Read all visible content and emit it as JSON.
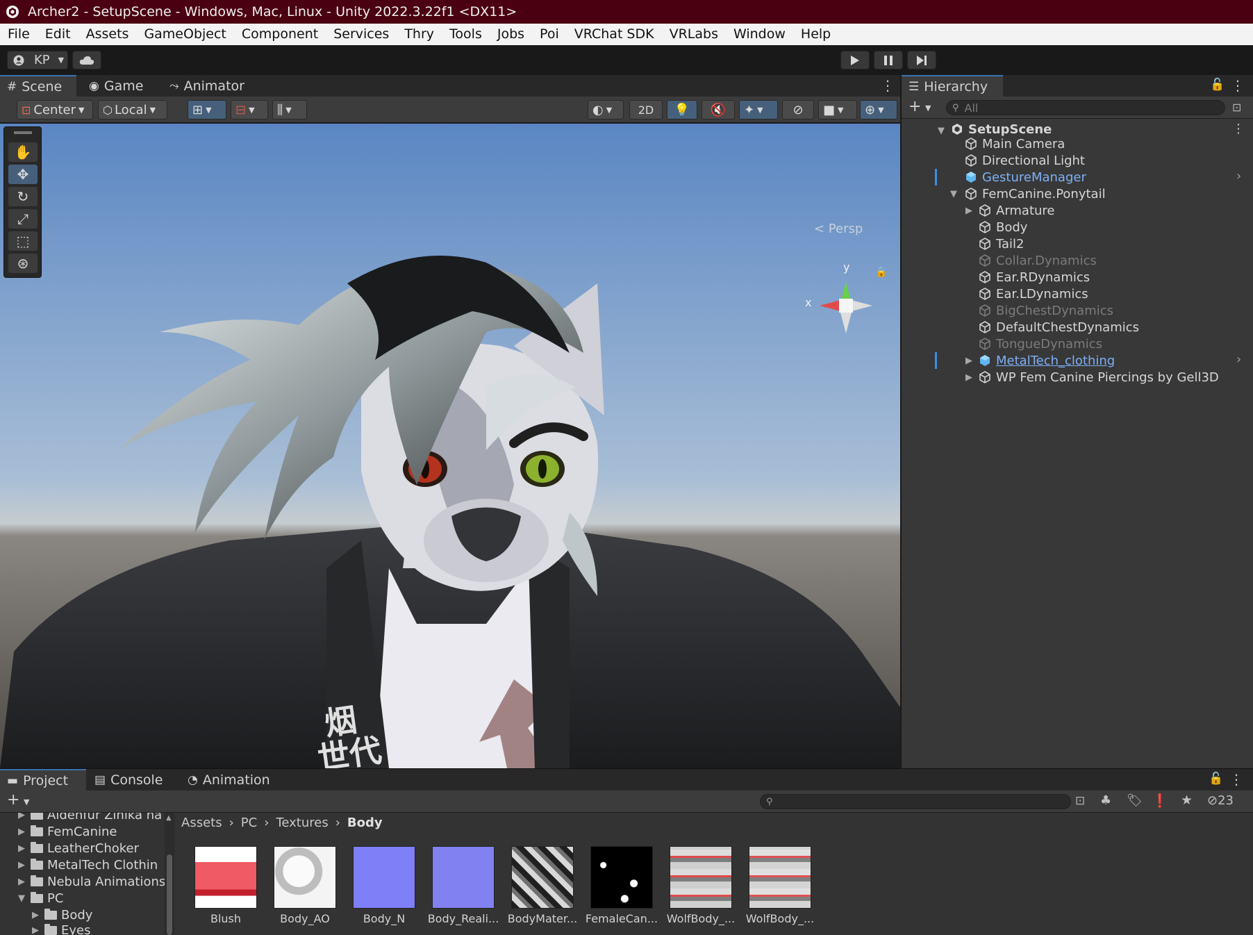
{
  "window": {
    "title": "Archer2 - SetupScene - Windows, Mac, Linux - Unity 2022.3.22f1 <DX11>"
  },
  "menu": [
    "File",
    "Edit",
    "Assets",
    "GameObject",
    "Component",
    "Services",
    "Thry",
    "Tools",
    "Jobs",
    "Poi",
    "VRChat SDK",
    "VRLabs",
    "Window",
    "Help"
  ],
  "toolbar": {
    "account": "KP",
    "play_icon": "play-icon",
    "pause_icon": "pause-icon",
    "step_icon": "step-icon"
  },
  "scene_tabs": {
    "scene": "Scene",
    "game": "Game",
    "animator": "Animator"
  },
  "scene_toolbar": {
    "pivot": "Center",
    "space": "Local",
    "mode_2d": "2D"
  },
  "gizmo": {
    "y_label": "y",
    "x_label": "x",
    "persp": "< Persp"
  },
  "hierarchy": {
    "title": "Hierarchy",
    "search_placeholder": "All",
    "scene": "SetupScene",
    "items": [
      {
        "label": "Main Camera",
        "state": "normal"
      },
      {
        "label": "Directional Light",
        "state": "normal"
      },
      {
        "label": "GestureManager",
        "state": "prefab"
      },
      {
        "label": "FemCanine.Ponytail",
        "state": "normal"
      },
      {
        "label": "Armature",
        "state": "normal"
      },
      {
        "label": "Body",
        "state": "normal"
      },
      {
        "label": "Tail2",
        "state": "normal"
      },
      {
        "label": "Collar.Dynamics",
        "state": "disabled"
      },
      {
        "label": "Ear.RDynamics",
        "state": "normal"
      },
      {
        "label": "Ear.LDynamics",
        "state": "normal"
      },
      {
        "label": "BigChestDynamics",
        "state": "disabled"
      },
      {
        "label": "DefaultChestDynamics",
        "state": "normal"
      },
      {
        "label": "TongueDynamics",
        "state": "disabled"
      },
      {
        "label": "MetalTech_clothing",
        "state": "prefab"
      },
      {
        "label": "WP Fem Canine Piercings by Gell3D",
        "state": "normal"
      }
    ]
  },
  "bottom_tabs": {
    "project": "Project",
    "console": "Console",
    "animation": "Animation"
  },
  "project": {
    "hidden_count": "23",
    "tree": [
      "Aldenfur Zinika na",
      "FemCanine",
      "LeatherChoker",
      "MetalTech Clothin",
      "Nebula Animations",
      "PC",
      "Body",
      "Eyes"
    ],
    "breadcrumb": [
      "Assets",
      "PC",
      "Textures",
      "Body"
    ],
    "assets": [
      "Blush",
      "Body_AO",
      "Body_N",
      "Body_Reali...",
      "BodyMater...",
      "FemaleCan...",
      "WolfBody_...",
      "WolfBody_..."
    ]
  }
}
